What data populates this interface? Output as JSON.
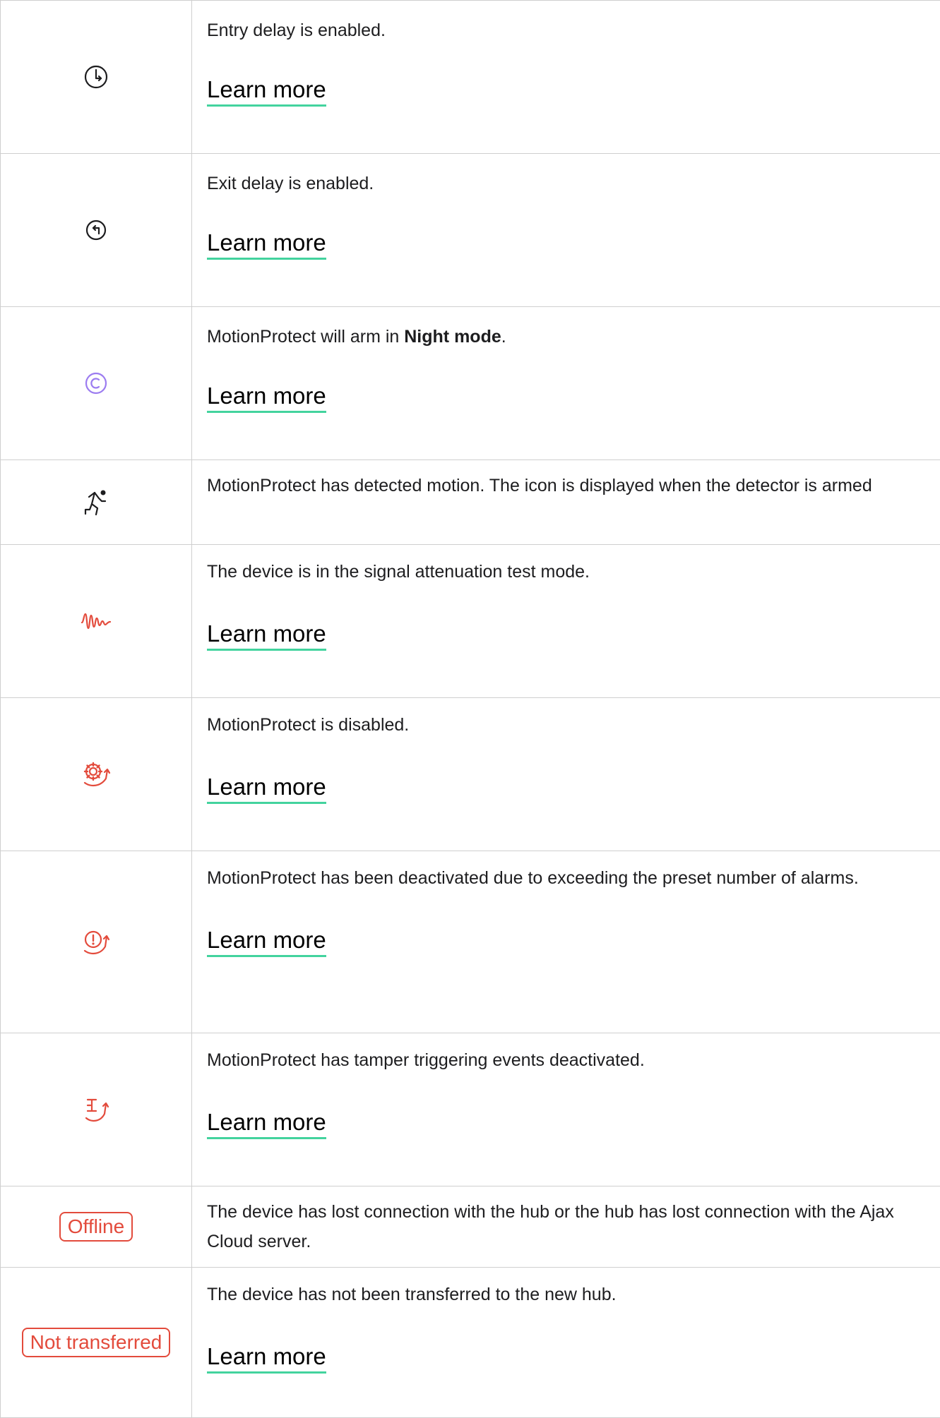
{
  "rows": [
    {
      "icon": "entry-delay-icon",
      "text": "Entry delay is enabled.",
      "link": "Learn more"
    },
    {
      "icon": "exit-delay-icon",
      "text": "Exit delay is enabled.",
      "link": "Learn more"
    },
    {
      "icon": "night-mode-icon",
      "text_pre": "MotionProtect will arm in ",
      "text_bold": "Night mode",
      "text_post": ".",
      "link": "Learn more"
    },
    {
      "icon": "motion-detected-icon",
      "text": "MotionProtect has detected motion. The icon is displayed when the detector is armed"
    },
    {
      "icon": "signal-attenuation-icon",
      "text": "The device is in the signal attenuation test mode.",
      "link": "Learn more"
    },
    {
      "icon": "device-disabled-icon",
      "text": "MotionProtect is disabled.",
      "link": "Learn more"
    },
    {
      "icon": "alarm-limit-deactivated-icon",
      "text": "MotionProtect has been deactivated due to exceeding the preset number of alarms.",
      "link": "Learn more"
    },
    {
      "icon": "tamper-deactivated-icon",
      "text": "MotionProtect has tamper triggering events deactivated.",
      "link": "Learn more"
    },
    {
      "badge": "Offline",
      "text": "The device has lost connection with the hub or the hub has lost connection with the Ajax Cloud server."
    },
    {
      "badge": "Not transferred",
      "text": "The device has not been transferred to the new hub.",
      "link": "Learn more"
    }
  ],
  "colors": {
    "link_underline": "#43d39e",
    "alert_red": "#e34b3c",
    "night_purple": "#9c7cf0"
  }
}
